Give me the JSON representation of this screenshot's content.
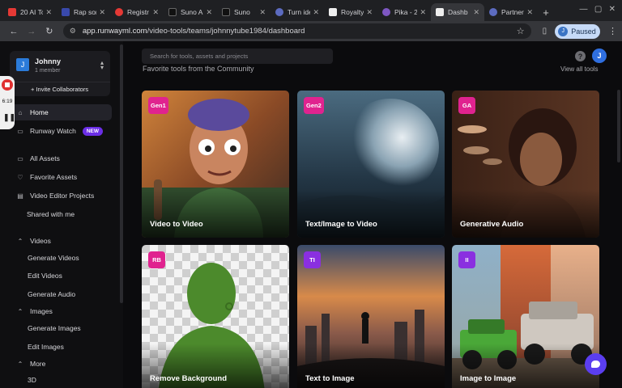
{
  "browser": {
    "tabs": [
      {
        "label": "20 AI To",
        "color": "#e53935"
      },
      {
        "label": "Rap son",
        "color": "#3949ab"
      },
      {
        "label": "Registr",
        "color": "#e53935"
      },
      {
        "label": "Suno AI",
        "color": "#111111"
      },
      {
        "label": "Suno",
        "color": "#111111"
      },
      {
        "label": "Turn ide",
        "color": "#5c6bc0"
      },
      {
        "label": "Royalty",
        "color": "#eeeeee"
      },
      {
        "label": "Pika - 2",
        "color": "#7e57c2"
      },
      {
        "label": "Dashb",
        "color": "#eeeeee"
      },
      {
        "label": "Partner",
        "color": "#5c6bc0"
      }
    ],
    "active_tab_index": 8,
    "url_host": "app.runwayml.com",
    "url_path": "/video-tools/teams/johnnytube1984/dashboard",
    "paused_label": "Paused",
    "profile_initial": "J"
  },
  "recording": {
    "time": "6:19"
  },
  "sidebar": {
    "team_initial": "J",
    "team_name": "Johnny",
    "team_members": "1 member",
    "invite_label": "+ Invite Collaborators",
    "home": "Home",
    "runway_watch": "Runway Watch",
    "new_badge": "NEW",
    "all_assets": "All Assets",
    "favorite_assets": "Favorite Assets",
    "video_editor_projects": "Video Editor Projects",
    "shared_with_me": "Shared with me",
    "videos_header": "Videos",
    "videos_items": [
      "Generate Videos",
      "Edit Videos",
      "Generate Audio"
    ],
    "images_header": "Images",
    "images_items": [
      "Generate Images",
      "Edit Images"
    ],
    "more_header": "More",
    "more_items": [
      "3D"
    ]
  },
  "main": {
    "search_placeholder": "Search for tools, assets and projects",
    "help_glyph": "?",
    "user_initial": "J",
    "section_title": "Favorite tools from the Community",
    "view_all": "View all tools",
    "cards": [
      {
        "code": "Gen1",
        "name": "Video to Video",
        "badge": "#e0238f"
      },
      {
        "code": "Gen2",
        "name": "Text/Image to Video",
        "badge": "#e0238f"
      },
      {
        "code": "GA",
        "name": "Generative Audio",
        "badge": "#e0238f"
      },
      {
        "code": "RB",
        "name": "Remove Background",
        "badge": "#e0238f"
      },
      {
        "code": "TI",
        "name": "Text to Image",
        "badge": "#8a2fe0"
      },
      {
        "code": "II",
        "name": "Image to Image",
        "badge": "#8a2fe0"
      }
    ]
  }
}
